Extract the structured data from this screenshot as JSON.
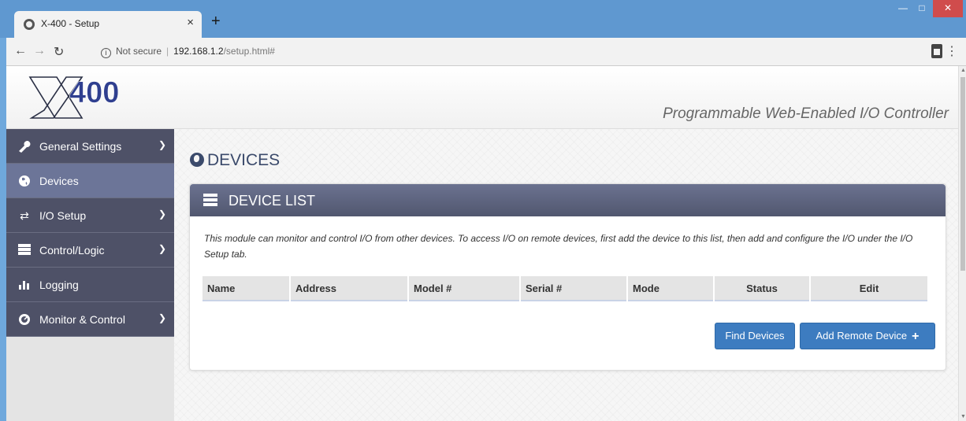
{
  "browser": {
    "tab_title": "X-400 - Setup",
    "tab_close": "×",
    "new_tab": "+",
    "security_label": "Not secure",
    "url_host": "192.168.1.2",
    "url_path": "/setup.html#"
  },
  "header": {
    "logo_text": "X400",
    "tagline": "Programmable Web-Enabled I/O Controller"
  },
  "sidebar": {
    "items": [
      {
        "label": "General Settings",
        "icon": "wrench-icon",
        "has_submenu": true
      },
      {
        "label": "Devices",
        "icon": "globe-icon",
        "active": true
      },
      {
        "label": "I/O Setup",
        "icon": "arrows-icon",
        "has_submenu": true
      },
      {
        "label": "Control/Logic",
        "icon": "server-icon",
        "has_submenu": true
      },
      {
        "label": "Logging",
        "icon": "bar-chart-icon"
      },
      {
        "label": "Monitor & Control",
        "icon": "gauge-icon",
        "has_submenu": true
      }
    ]
  },
  "main": {
    "title": "DEVICES",
    "panel_title": "DEVICE LIST",
    "description": "This module can monitor and control I/O from other devices. To access I/O on remote devices, first add the device to this list, then add and configure the I/O under the I/O Setup tab.",
    "table_headers": [
      "Name",
      "Address",
      "Model #",
      "Serial #",
      "Mode",
      "Status",
      "Edit"
    ],
    "find_button": "Find Devices",
    "add_button": "Add Remote Device"
  },
  "colors": {
    "sidebar_bg": "#4e5167",
    "sidebar_active": "#6c7598",
    "panel_header": "#5d6480",
    "button": "#3d7cc0",
    "title": "#3b4a6b"
  }
}
